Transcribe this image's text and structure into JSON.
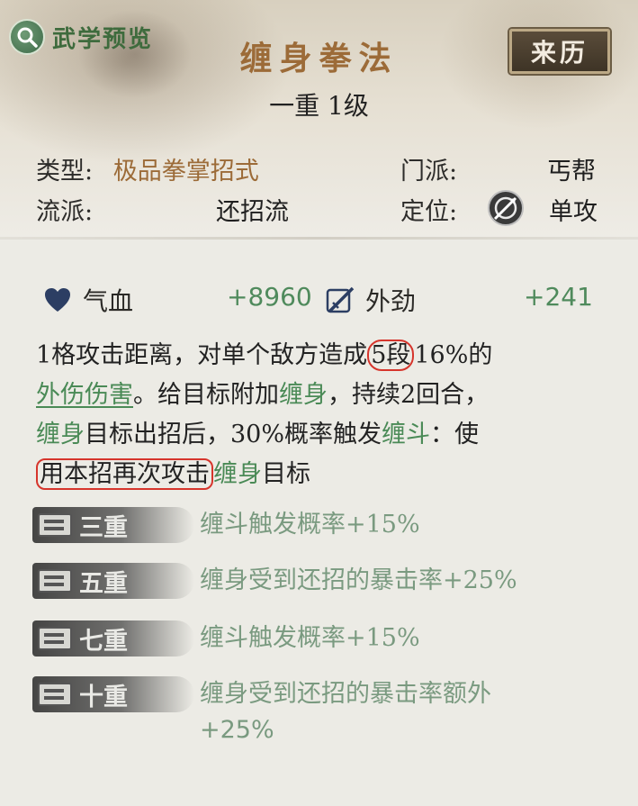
{
  "header": {
    "preview_label": "武学预览",
    "skill_name": "缠身拳法",
    "level": "一重 1级",
    "origin_button": "来历"
  },
  "info": {
    "type_label": "类型:",
    "type_value": "极品拳掌招式",
    "sect_label": "门派:",
    "sect_value": "丐帮",
    "school_label": "流派:",
    "school_value": "还招流",
    "role_label": "定位:",
    "role_value": "单攻"
  },
  "stats": {
    "hp_label": "气血",
    "hp_value": "+8960",
    "outer_label": "外劲",
    "outer_value": "+241"
  },
  "description": {
    "line1_a": "1格攻击距离，对单个敌方造成",
    "line1_mark": "5段",
    "line1_b": "16%的",
    "line2_kw": "外伤伤害",
    "line2_a": "。给目标附加",
    "line2_kw2": "缠身",
    "line2_b": "，持续2回合，",
    "line3_kw": "缠身",
    "line3_a": "目标出招后，30%概率触发",
    "line3_kw2": "缠斗",
    "line3_b": "：使",
    "line4_mark": "用本招再次攻击",
    "line4_kw": "缠身",
    "line4_b": "目标"
  },
  "tiers": [
    {
      "label": "三重",
      "effect": "缠斗触发概率+15%"
    },
    {
      "label": "五重",
      "effect": "缠身受到还招的暴击率+25%"
    },
    {
      "label": "七重",
      "effect": "缠斗触发概率+15%"
    },
    {
      "label": "十重",
      "effect": "缠身受到还招的暴击率额外",
      "effect2": "+25%"
    }
  ],
  "colors": {
    "title_gold": "#9c6b38",
    "keyword_green": "#4a8a56",
    "stat_green": "#4f8a5c",
    "annotation_red": "#d6352c",
    "tier_effect": "#7a9a80"
  },
  "icons": {
    "preview": "magnifier-icon",
    "role": "single-target-icon",
    "hp": "heart-icon",
    "outer": "sword-icon",
    "tier": "scroll-icon"
  }
}
